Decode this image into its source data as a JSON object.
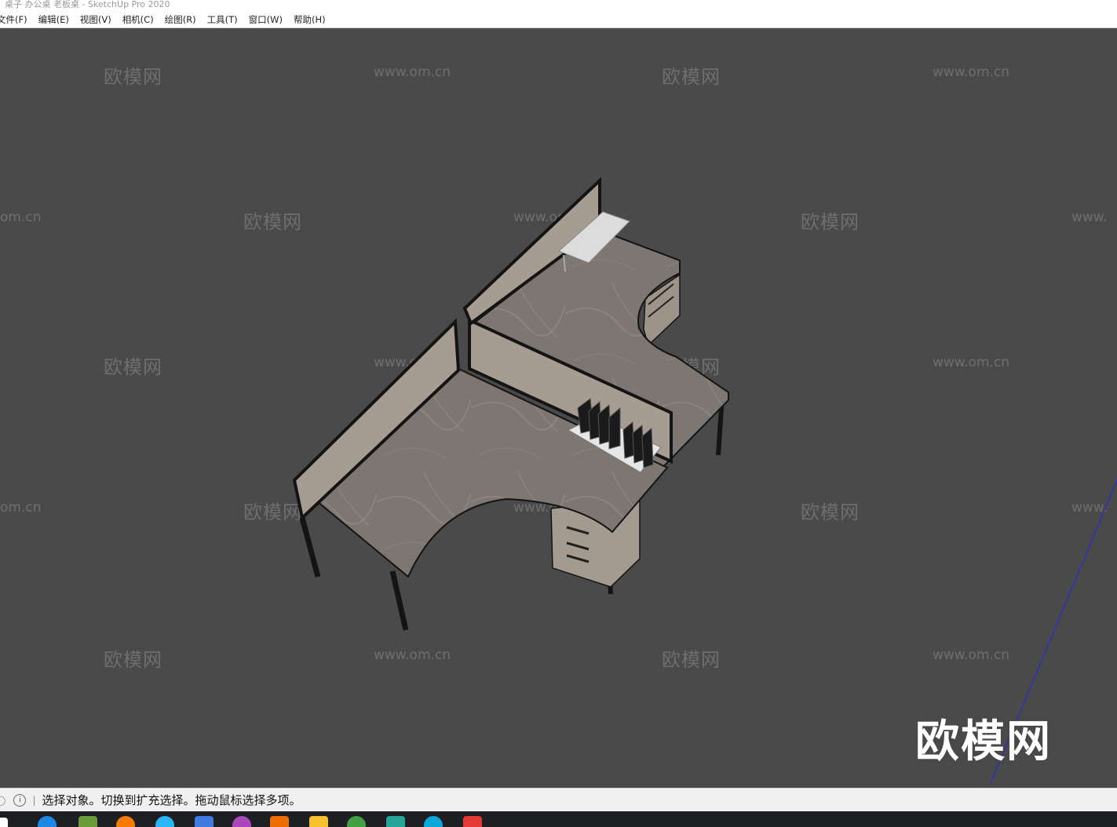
{
  "window": {
    "title": "桌子 办公桌 老板桌 - SketchUp Pro 2020"
  },
  "menu": [
    "文件(F)",
    "编辑(E)",
    "视图(V)",
    "相机(C)",
    "绘图(R)",
    "工具(T)",
    "窗口(W)",
    "帮助(H)"
  ],
  "watermarks": {
    "brand": "欧模网",
    "url": "www.om.cn",
    "url_partial": "om.cn",
    "url_partial_right": "www.",
    "big_brand": "欧模网"
  },
  "status": {
    "info_icon": "info-icon",
    "text": "选择对象。切换到扩充选择。拖动鼠标选择多项。"
  },
  "colors": {
    "viewport_bg": "#4a4a4a",
    "desk_top": "#7e7670",
    "partition": "#a79c92",
    "frame": "#141414",
    "axis_blue": "#2a2ad8"
  },
  "taskbar_icons": [
    "windows-start-icon",
    "ie-icon",
    "minecraft-icon",
    "video-player-icon",
    "browser-icon",
    "app-icon",
    "colorful-app-icon",
    "photo-app-icon",
    "folder-icon",
    "wechat-icon",
    "3d-app-icon",
    "edge-icon",
    "sketchup-icon"
  ]
}
